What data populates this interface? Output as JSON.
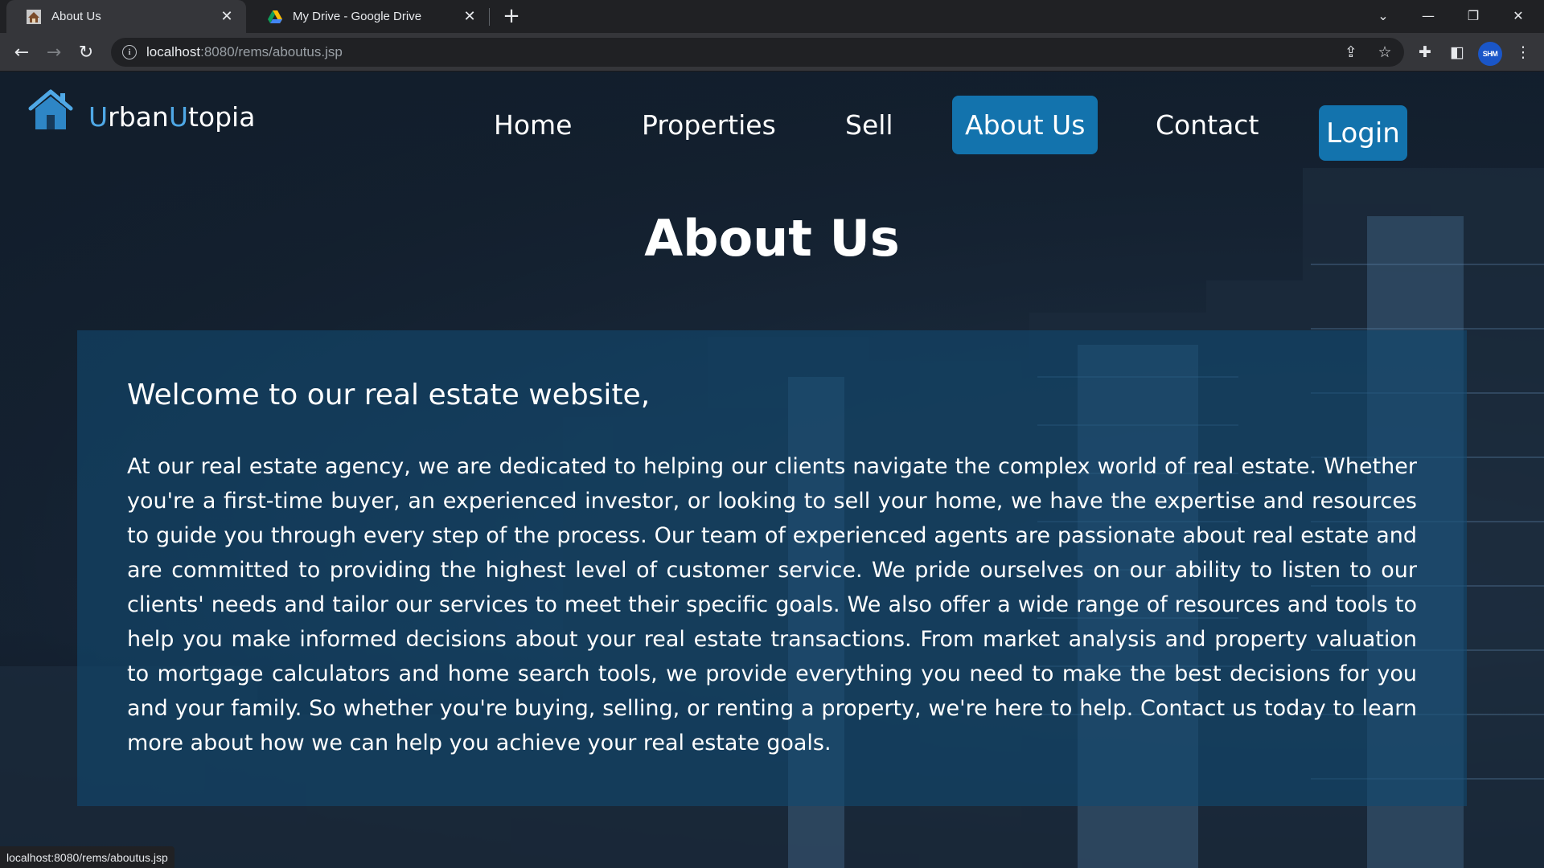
{
  "browser": {
    "tabs": [
      {
        "title": "About Us",
        "favicon": "house-favicon-icon",
        "active": true
      },
      {
        "title": "My Drive - Google Drive",
        "favicon": "google-drive-icon",
        "active": false
      }
    ],
    "url_host": "localhost",
    "url_path": ":8080/rems/aboutus.jsp",
    "profile_label": "SHM",
    "status_url": "localhost:8080/rems/aboutus.jsp"
  },
  "site": {
    "logo_part1": "U",
    "logo_part2": "rban",
    "logo_part3": "U",
    "logo_part4": "topia",
    "accent_color": "#4fa8e6",
    "primary_color": "#1373ad",
    "nav": [
      {
        "label": "Home"
      },
      {
        "label": "Properties"
      },
      {
        "label": "Sell"
      },
      {
        "label": "About Us",
        "active": true
      },
      {
        "label": "Contact"
      }
    ],
    "login_label": "Login"
  },
  "page": {
    "title": "About Us",
    "welcome": "Welcome to our real estate website,",
    "body": "At our real estate agency, we are dedicated to helping our clients navigate the complex world of real estate. Whether you're a first-time buyer, an experienced investor, or looking to sell your home, we have the expertise and resources to guide you through every step of the process. Our team of experienced agents are passionate about real estate and are committed to providing the highest level of customer service. We pride ourselves on our ability to listen to our clients' needs and tailor our services to meet their specific goals. We also offer a wide range of resources and tools to help you make informed decisions about your real estate transactions. From market analysis and property valuation to mortgage calculators and home search tools, we provide everything you need to make the best decisions for you and your family. So whether you're buying, selling, or renting a property, we're here to help. Contact us today to learn more about how we can help you achieve your real estate goals."
  }
}
